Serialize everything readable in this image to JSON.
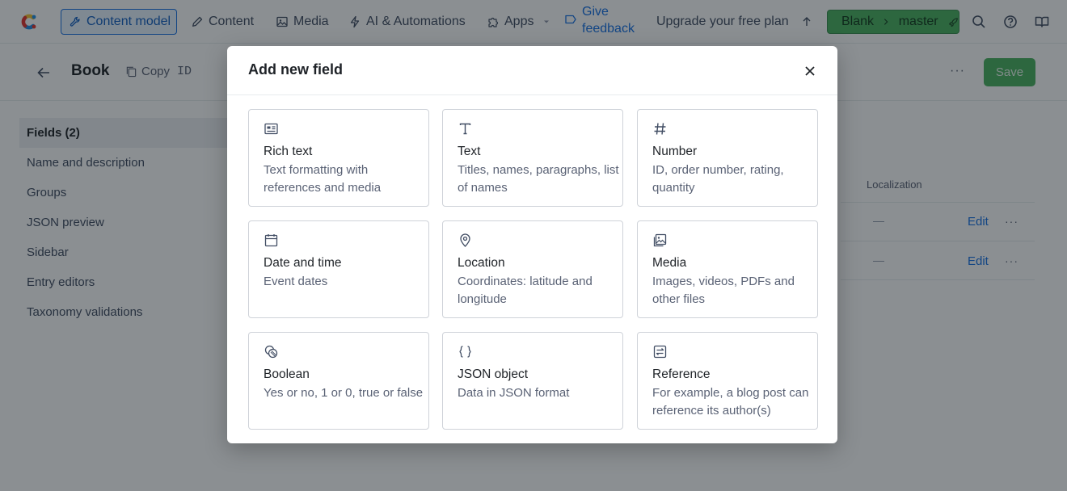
{
  "topnav": {
    "content_model": "Content model",
    "content": "Content",
    "media": "Media",
    "ai": "AI & Automations",
    "apps": "Apps",
    "feedback": "Give feedback",
    "upgrade": "Upgrade your free plan",
    "env_space": "Blank",
    "env_branch": "master"
  },
  "page": {
    "title": "Book",
    "copy_label": "Copy",
    "id_label": "ID",
    "more": "···",
    "save_label": "Save"
  },
  "sidenav": {
    "items": [
      {
        "label": "Fields (2)"
      },
      {
        "label": "Name and description"
      },
      {
        "label": "Groups"
      },
      {
        "label": "JSON preview"
      },
      {
        "label": "Sidebar"
      },
      {
        "label": "Entry editors"
      },
      {
        "label": "Taxonomy validations"
      }
    ]
  },
  "fields_table": {
    "localization_header": "Localization",
    "rows": [
      {
        "localization": "—",
        "edit": "Edit",
        "more": "···"
      },
      {
        "localization": "—",
        "edit": "Edit",
        "more": "···"
      }
    ]
  },
  "modal": {
    "title": "Add new field",
    "cards": [
      {
        "icon": "rich-text-icon",
        "title": "Rich text",
        "desc": "Text formatting with references and media"
      },
      {
        "icon": "text-icon",
        "title": "Text",
        "desc": "Titles, names, paragraphs, list of names"
      },
      {
        "icon": "number-icon",
        "title": "Number",
        "desc": "ID, order number, rating, quantity"
      },
      {
        "icon": "calendar-icon",
        "title": "Date and time",
        "desc": "Event dates"
      },
      {
        "icon": "location-pin-icon",
        "title": "Location",
        "desc": "Coordinates: latitude and longitude"
      },
      {
        "icon": "media-icon",
        "title": "Media",
        "desc": "Images, videos, PDFs and other files"
      },
      {
        "icon": "boolean-icon",
        "title": "Boolean",
        "desc": "Yes or no, 1 or 0, true or false"
      },
      {
        "icon": "json-icon",
        "title": "JSON object",
        "desc": "Data in JSON format"
      },
      {
        "icon": "reference-icon",
        "title": "Reference",
        "desc": "For example, a blog post can reference its author(s)"
      }
    ]
  },
  "colors": {
    "accent": "#1872e5",
    "env_green": "#4cb360",
    "overlay": "rgba(12,20,28,0.48)"
  }
}
